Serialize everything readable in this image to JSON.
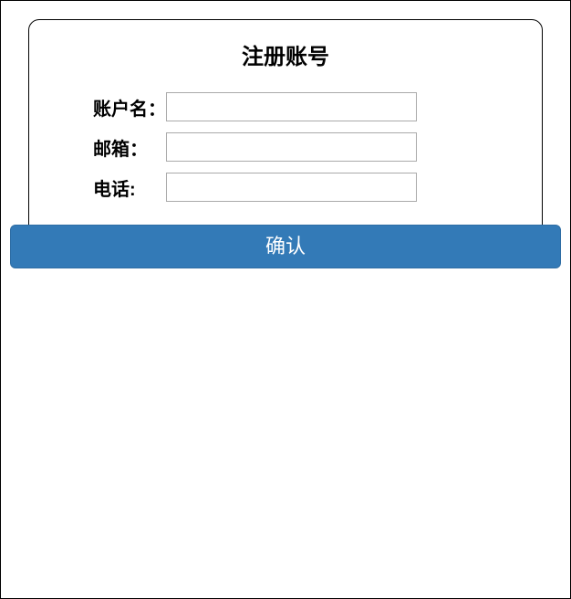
{
  "form": {
    "title": "注册账号",
    "fields": {
      "username": {
        "label": "账户名：",
        "value": ""
      },
      "email": {
        "label": "邮箱：",
        "value": ""
      },
      "phone": {
        "label": "电话:",
        "value": ""
      }
    },
    "submit_label": "确认"
  }
}
